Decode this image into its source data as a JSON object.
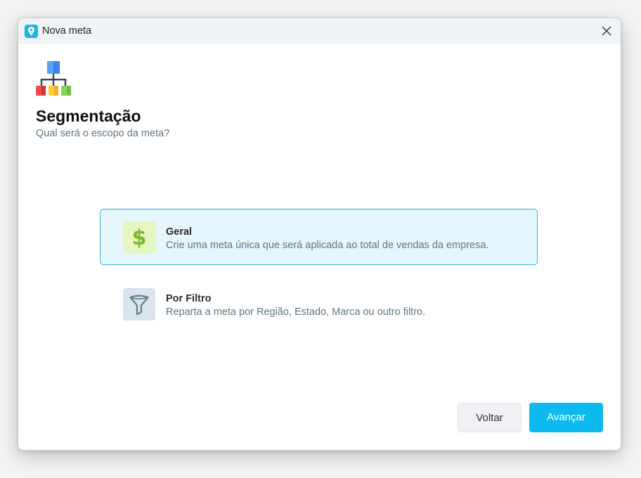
{
  "window": {
    "title": "Nova meta",
    "accent_color": "#19b6e8"
  },
  "header": {
    "title": "Segmentação",
    "subtitle": "Qual será o escopo da meta?"
  },
  "options": [
    {
      "title": "Geral",
      "description": "Crie uma meta única que será aplicada ao total de vendas da empresa.",
      "icon": "dollar-icon",
      "selected": true
    },
    {
      "title": "Por Filtro",
      "description": "Reparta a meta por Região, Estado, Marca ou outro filtro.",
      "icon": "funnel-icon",
      "selected": false
    }
  ],
  "footer": {
    "back_label": "Voltar",
    "next_label": "Avançar",
    "next_color": "#0cbaef"
  }
}
